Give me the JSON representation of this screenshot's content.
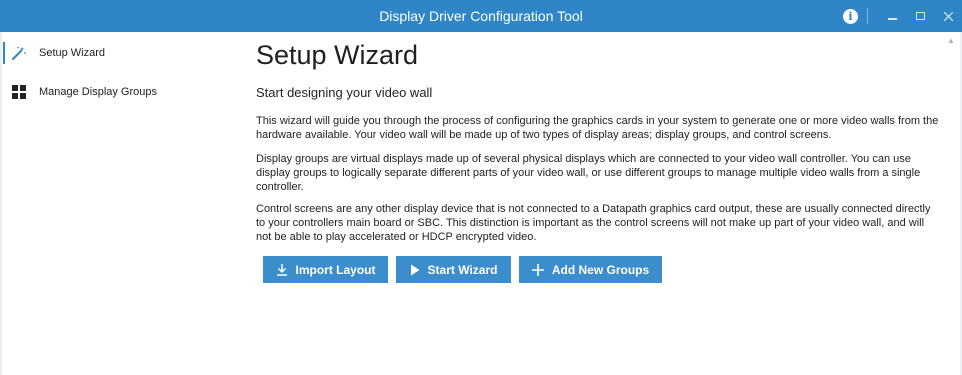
{
  "window": {
    "title": "Display Driver Configuration Tool",
    "accent_color": "#2f85c5",
    "controls": {
      "info_icon": "info-icon",
      "minimize": "–",
      "maximize": "□",
      "close": "✕"
    }
  },
  "sidebar": {
    "items": [
      {
        "label": "Setup Wizard",
        "icon": "magic-wand-icon",
        "selected": true
      },
      {
        "label": "Manage Display Groups",
        "icon": "grid-icon",
        "selected": false
      }
    ]
  },
  "main": {
    "title": "Setup Wizard",
    "subtitle": "Start designing your video wall",
    "paragraphs": [
      "This wizard will guide you through the process of configuring the graphics cards in your system to generate one or more video walls from the hardware available. Your video wall will be made up of two types of display areas; display groups, and control screens.",
      "Display groups are virtual displays made up of several physical displays which are connected to your video wall controller. You can use display groups to logically separate different parts of your video wall, or use different groups to manage multiple video walls from a single controller.",
      "Control screens are any other display device that is not connected to a Datapath graphics card output, these are usually connected directly to your controllers main board or SBC. This distinction is important as the control screens will not make up part of your video wall, and will not be able to play accelerated or HDCP encrypted video."
    ],
    "buttons": {
      "import": {
        "label": "Import Layout",
        "icon": "download-icon"
      },
      "start": {
        "label": "Start Wizard",
        "icon": "play-icon"
      },
      "add": {
        "label": "Add New Groups",
        "icon": "plus-icon"
      }
    },
    "button_color": "#3c8dcb"
  }
}
